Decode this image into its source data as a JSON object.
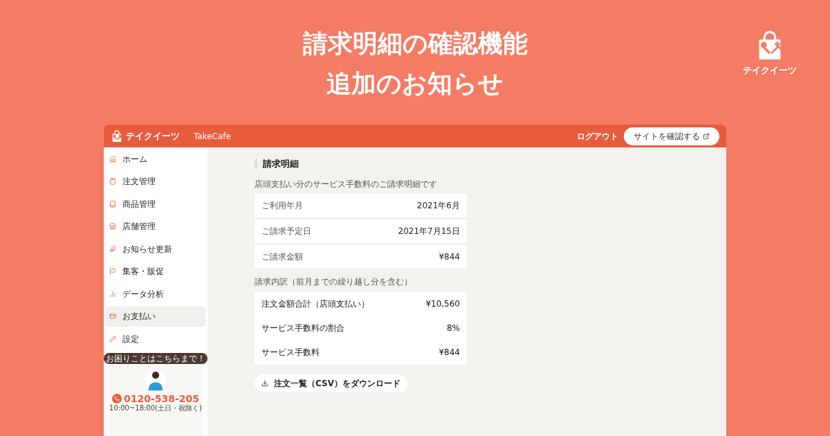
{
  "headline": [
    "請求明細の確認機能",
    "追加のお知らせ"
  ],
  "brand": {
    "name": "テイクイーツ"
  },
  "header": {
    "logo_text": "テイクイーツ",
    "shop_name": "TakeCafe",
    "logout": "ログアウト",
    "site_button": "サイトを確認する"
  },
  "sidebar": {
    "items": [
      {
        "label": "ホーム",
        "selected": false
      },
      {
        "label": "注文管理",
        "selected": false
      },
      {
        "label": "商品管理",
        "selected": false
      },
      {
        "label": "店舗管理",
        "selected": false
      },
      {
        "label": "お知らせ更新",
        "selected": false
      },
      {
        "label": "集客・販促",
        "selected": false
      },
      {
        "label": "データ分析",
        "selected": false
      },
      {
        "label": "お支払い",
        "selected": true
      },
      {
        "label": "設定",
        "selected": false
      }
    ],
    "support": {
      "bubble": "お困りことはこちらまで！",
      "phone": "0120-538-205",
      "hours": "10:00~18:00(土日・祝除く)"
    }
  },
  "page": {
    "title": "請求明細",
    "description": "店頭支払い分のサービス手数料のご請求明細です",
    "summary": [
      {
        "label": "ご利用年月",
        "value": "2021年6月"
      },
      {
        "label": "ご請求予定日",
        "value": "2021年7月15日"
      },
      {
        "label": "ご請求金額",
        "value": "¥844"
      }
    ],
    "breakdown_label": "請求内訳（前月までの繰り越し分を含む）",
    "breakdown": [
      {
        "label": "注文金額合計（店頭支払い）",
        "value": "¥10,560"
      },
      {
        "label": "サービス手数料の割合",
        "value": "8%"
      },
      {
        "label": "サービス手数料",
        "value": "¥844"
      }
    ],
    "download_button": "注文一覧（CSV）をダウンロード"
  }
}
